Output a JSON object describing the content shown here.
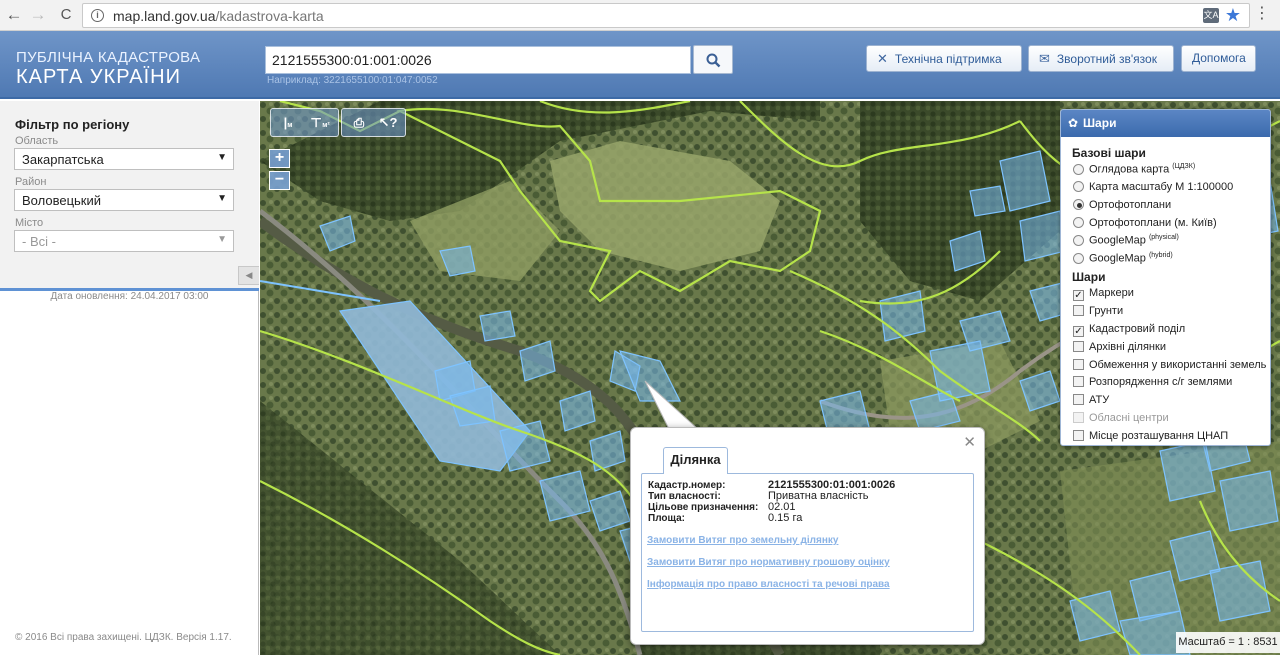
{
  "browser": {
    "url_host": "map.land.gov.ua",
    "url_path": "/kadastrova-karta"
  },
  "header": {
    "brand_line1": "ПУБЛІЧНА КАДАСТРОВА",
    "brand_line2": "КАРТА УКРАЇНИ",
    "search_value": "2121555300:01:001:0026",
    "search_example": "Наприклад: 3221655100:01:047:0052",
    "support_label": "Технічна підтримка",
    "feedback_label": "Зворотний зв'язок",
    "help_label": "Допомога"
  },
  "sidebar": {
    "title": "Фільтр по регіону",
    "oblast_label": "Область",
    "oblast_value": "Закарпатська",
    "raion_label": "Район",
    "raion_value": "Воловецький",
    "misto_label": "Місто",
    "misto_value": "- Всі -",
    "update_date": "Дата оновлення: 24.04.2017 03:00",
    "copyright": "© 2016 Всі права захищені. ЦДЗК. Версія 1.17."
  },
  "map_tools": {
    "zoom_in": "+",
    "zoom_out": "−"
  },
  "layers": {
    "title": "Шари",
    "base_title": "Базові шари",
    "base": [
      {
        "label": "Оглядова карта",
        "sup": "(ЦДЗК)",
        "selected": false
      },
      {
        "label": "Карта масштабу М 1:100000",
        "sup": "",
        "selected": false
      },
      {
        "label": "Ортофотоплани",
        "sup": "",
        "selected": true
      },
      {
        "label": "Ортофотоплани (м. Київ)",
        "sup": "",
        "selected": false
      },
      {
        "label": "GoogleMap",
        "sup": "(physical)",
        "selected": false
      },
      {
        "label": "GoogleMap",
        "sup": "(hybrid)",
        "selected": false
      }
    ],
    "overlay_title": "Шари",
    "overlays": [
      {
        "label": "Маркери",
        "checked": true
      },
      {
        "label": "Грунти",
        "checked": false
      },
      {
        "label": "Кадастровий поділ",
        "checked": true
      },
      {
        "label": "Архівні ділянки",
        "checked": false
      },
      {
        "label": "Обмеження у використанні земель",
        "checked": false
      },
      {
        "label": "Розпорядження с/г землями",
        "checked": false
      },
      {
        "label": "АТУ",
        "checked": false
      },
      {
        "label": "Обласні центри",
        "checked": false
      },
      {
        "label": "Місце розташування ЦНАП",
        "checked": false
      }
    ]
  },
  "popup": {
    "tab": "Ділянка",
    "cad_key": "Кадастр.номер:",
    "cad_val": "2121555300:01:001:0026",
    "own_key": "Тип власності:",
    "own_val": "Приватна власність",
    "purpose_key": "Цільове призначення:",
    "purpose_val": "02.01",
    "area_key": "Площа:",
    "area_val": "0.15 га",
    "link1": "Замовити Витяг про земельну ділянку",
    "link2": "Замовити Витяг про нормативну грошову оцінку",
    "link3": "Інформація про право власності та речові права"
  },
  "scale": "Масштаб = 1 : 8531"
}
